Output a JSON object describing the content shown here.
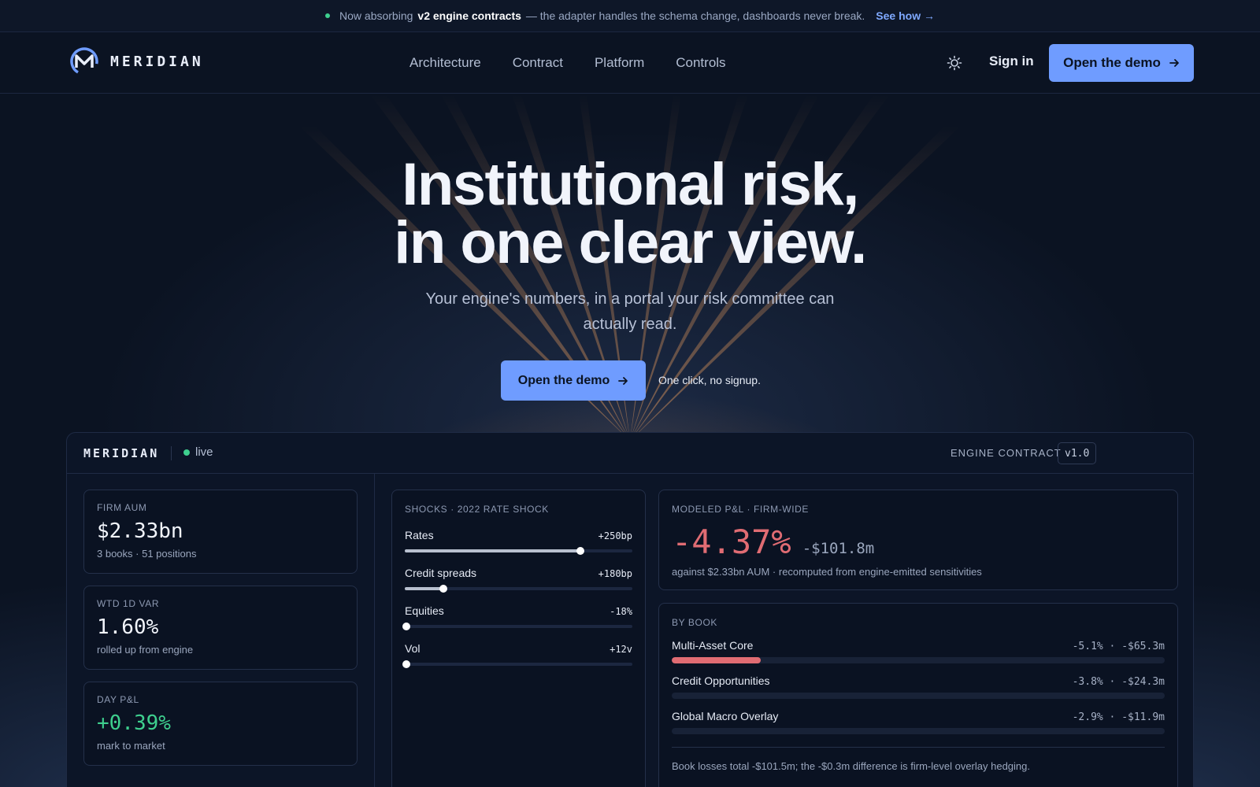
{
  "announcement": {
    "prefix": "Now absorbing",
    "highlight": "v2 engine contracts",
    "suffix": "— the adapter handles the schema change, dashboards never break.",
    "link": "See how →"
  },
  "nav": {
    "brand": "MERIDIAN",
    "links": [
      "Architecture",
      "Contract",
      "Platform",
      "Controls"
    ],
    "theme_icon": "sun-icon",
    "signin": "Sign in",
    "cta": "Open the demo"
  },
  "hero": {
    "title_line1": "Institutional risk,",
    "title_line2": "in one clear view.",
    "subtitle": "Your engine's numbers, in a portal your risk committee can actually read.",
    "cta": "Open the demo",
    "note": "One click, no signup."
  },
  "dashboard": {
    "brand": "MERIDIAN",
    "status": "live",
    "contract_label": "ENGINE CONTRACT",
    "contract_version": "v1.0",
    "stats": [
      {
        "label": "FIRM AUM",
        "value": "$2.33bn",
        "sub": "3 books · 51 positions",
        "positive": false
      },
      {
        "label": "WTD 1D VAR",
        "value": "1.60%",
        "sub": "rolled up from engine",
        "positive": false
      },
      {
        "label": "DAY P&L",
        "value": "+0.39%",
        "sub": "mark to market",
        "positive": true
      }
    ],
    "shocks": {
      "title": "SHOCKS · 2022 RATE SHOCK",
      "items": [
        {
          "name": "Rates",
          "value": "+250bp",
          "level": 0.77
        },
        {
          "name": "Credit spreads",
          "value": "+180bp",
          "level": 0.17
        },
        {
          "name": "Equities",
          "value": "-18%",
          "level": 0.0
        },
        {
          "name": "Vol",
          "value": "+12v",
          "level": 0.0
        }
      ]
    },
    "pnl": {
      "title": "MODELED P&L · FIRM-WIDE",
      "pct": "-4.37%",
      "abs": "-$101.8m",
      "note": "against $2.33bn AUM · recomputed from engine-emitted sensitivities"
    },
    "books": {
      "title": "BY BOOK",
      "items": [
        {
          "name": "Multi-Asset Core",
          "value": "-5.1% · -$65.3m",
          "level": 0.18
        },
        {
          "name": "Credit Opportunities",
          "value": "-3.8% · -$24.3m",
          "level": 0.0
        },
        {
          "name": "Global Macro Overlay",
          "value": "-2.9% · -$11.9m",
          "level": 0.0
        }
      ],
      "note": "Book losses total -$101.5m; the -$0.3m difference is firm-level overlay hedging."
    }
  },
  "colors": {
    "accent": "#6f9cff",
    "live": "#3ecf8e",
    "loss": "#e06c73",
    "background": "#0b1322"
  }
}
